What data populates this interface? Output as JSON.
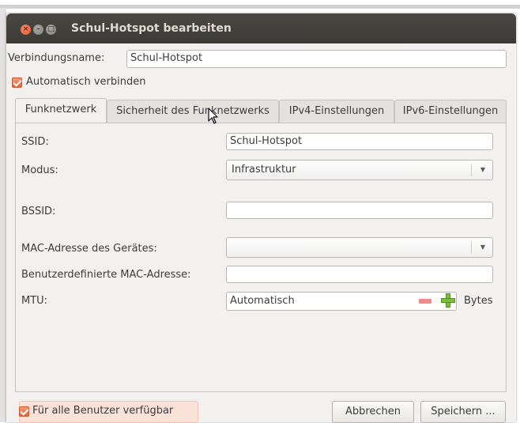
{
  "window": {
    "title": "Schul-Hotspot bearbeiten"
  },
  "connection": {
    "name_label": "Verbindungsname:",
    "name_value": "Schul-Hotspot"
  },
  "auto_connect": {
    "label": "Automatisch verbinden",
    "checked": true
  },
  "tabs": [
    {
      "label": "Funknetzwerk",
      "active": true
    },
    {
      "label": "Sicherheit des Funknetzwerks",
      "active": false
    },
    {
      "label": "IPv4-Einstellungen",
      "active": false
    },
    {
      "label": "IPv6-Einstellungen",
      "active": false
    }
  ],
  "form": {
    "ssid_label": "SSID:",
    "ssid_value": "Schul-Hotspot",
    "mode_label": "Modus:",
    "mode_value": "Infrastruktur",
    "bssid_label": "BSSID:",
    "bssid_value": "",
    "mac_label": "MAC-Adresse des Gerätes:",
    "mac_value": "",
    "custom_mac_label": "Benutzerdefinierte MAC-Adresse:",
    "custom_mac_value": "",
    "mtu_label": "MTU:",
    "mtu_value": "Automatisch",
    "mtu_unit": "Bytes"
  },
  "footer": {
    "all_users_label": "Für alle Benutzer verfügbar",
    "all_users_checked": true,
    "cancel_label": "Abbrechen",
    "save_label": "Speichern ..."
  },
  "colors": {
    "accent": "#e3643a",
    "titlebar": "#3c3b37",
    "background": "#f2f1f0"
  },
  "icons": [
    "close-icon",
    "minimize-icon",
    "maximize-icon",
    "checkbox-checked-icon",
    "chevron-down-icon",
    "minus-icon",
    "plus-icon",
    "mouse-cursor-icon"
  ]
}
